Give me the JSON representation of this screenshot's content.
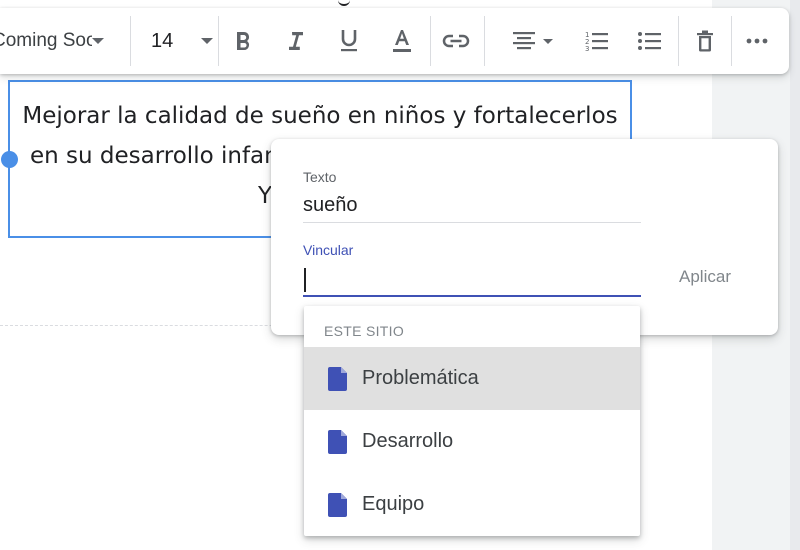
{
  "toolbar": {
    "font_name": "Coming Soon",
    "font_size": "14",
    "buttons": {
      "bold": "bold-icon",
      "italic": "italic-icon",
      "underline": "underline-icon",
      "text_color": "text-color-icon",
      "link": "link-icon",
      "align": "align-center-icon",
      "numbered_list": "numbered-list-icon",
      "bulleted_list": "bulleted-list-icon",
      "delete": "trash-icon",
      "more": "more-horizontal-icon"
    }
  },
  "textbox": {
    "line1": "Mejorar la calidad de sueño en niños y fortalecerlos",
    "line2": "en su desarrollo infan",
    "line3": "Y"
  },
  "link_dialog": {
    "text_label": "Texto",
    "text_value": "sueño",
    "link_label": "Vincular",
    "link_value": "",
    "apply_label": "Aplicar"
  },
  "suggestions": {
    "section_title": "ESTE SITIO",
    "items": [
      {
        "label": "Problemática",
        "icon": "page-icon",
        "highlighted": true
      },
      {
        "label": "Desarrollo",
        "icon": "page-icon",
        "highlighted": false
      },
      {
        "label": "Equipo",
        "icon": "page-icon",
        "highlighted": false
      }
    ]
  },
  "colors": {
    "accent": "#3f51b5",
    "selection_border": "#4a8fe7",
    "page_icon": "#3f51b5"
  }
}
